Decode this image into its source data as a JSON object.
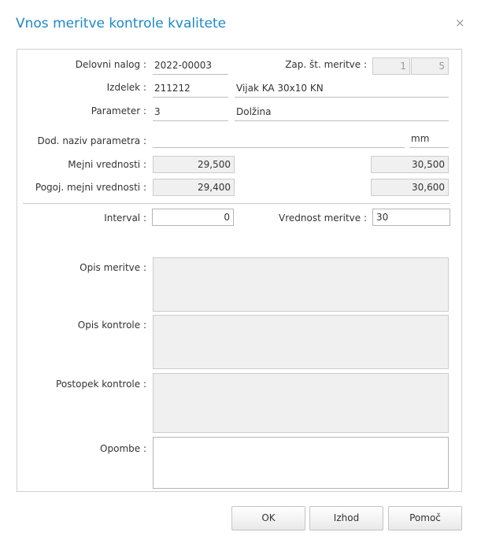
{
  "dialog": {
    "title": "Vnos meritve kontrole kvalitete",
    "close_symbol": "×"
  },
  "form": {
    "delovni_nalog": {
      "label": "Delovni nalog :",
      "value": "2022-00003"
    },
    "zap_st_meritve": {
      "label": "Zap. št. meritve :",
      "value1": "1",
      "value2": "5"
    },
    "izdelek": {
      "label": "Izdelek :",
      "code": "211212",
      "name": "Vijak KA 30x10 KN"
    },
    "parameter": {
      "label": "Parameter :",
      "code": "3",
      "name": "Dolžina"
    },
    "dod_naziv": {
      "label": "Dod. naziv parametra :",
      "value": "",
      "unit": "mm"
    },
    "mejni": {
      "label": "Mejni vrednosti :",
      "min": "29,500",
      "max": "30,500"
    },
    "pogoj_mejni": {
      "label": "Pogoj. mejni vrednosti :",
      "min": "29,400",
      "max": "30,600"
    },
    "interval": {
      "label": "Interval :",
      "value": "0"
    },
    "vrednost_meritve": {
      "label": "Vrednost meritve :",
      "value": "30"
    },
    "opis_meritve": {
      "label": "Opis meritve :",
      "value": ""
    },
    "opis_kontrole": {
      "label": "Opis kontrole :",
      "value": ""
    },
    "postopek_kontrole": {
      "label": "Postopek kontrole :",
      "value": ""
    },
    "opombe": {
      "label": "Opombe :",
      "value": ""
    }
  },
  "buttons": {
    "ok": "OK",
    "izhod": "Izhod",
    "pomoc": "Pomoč"
  }
}
